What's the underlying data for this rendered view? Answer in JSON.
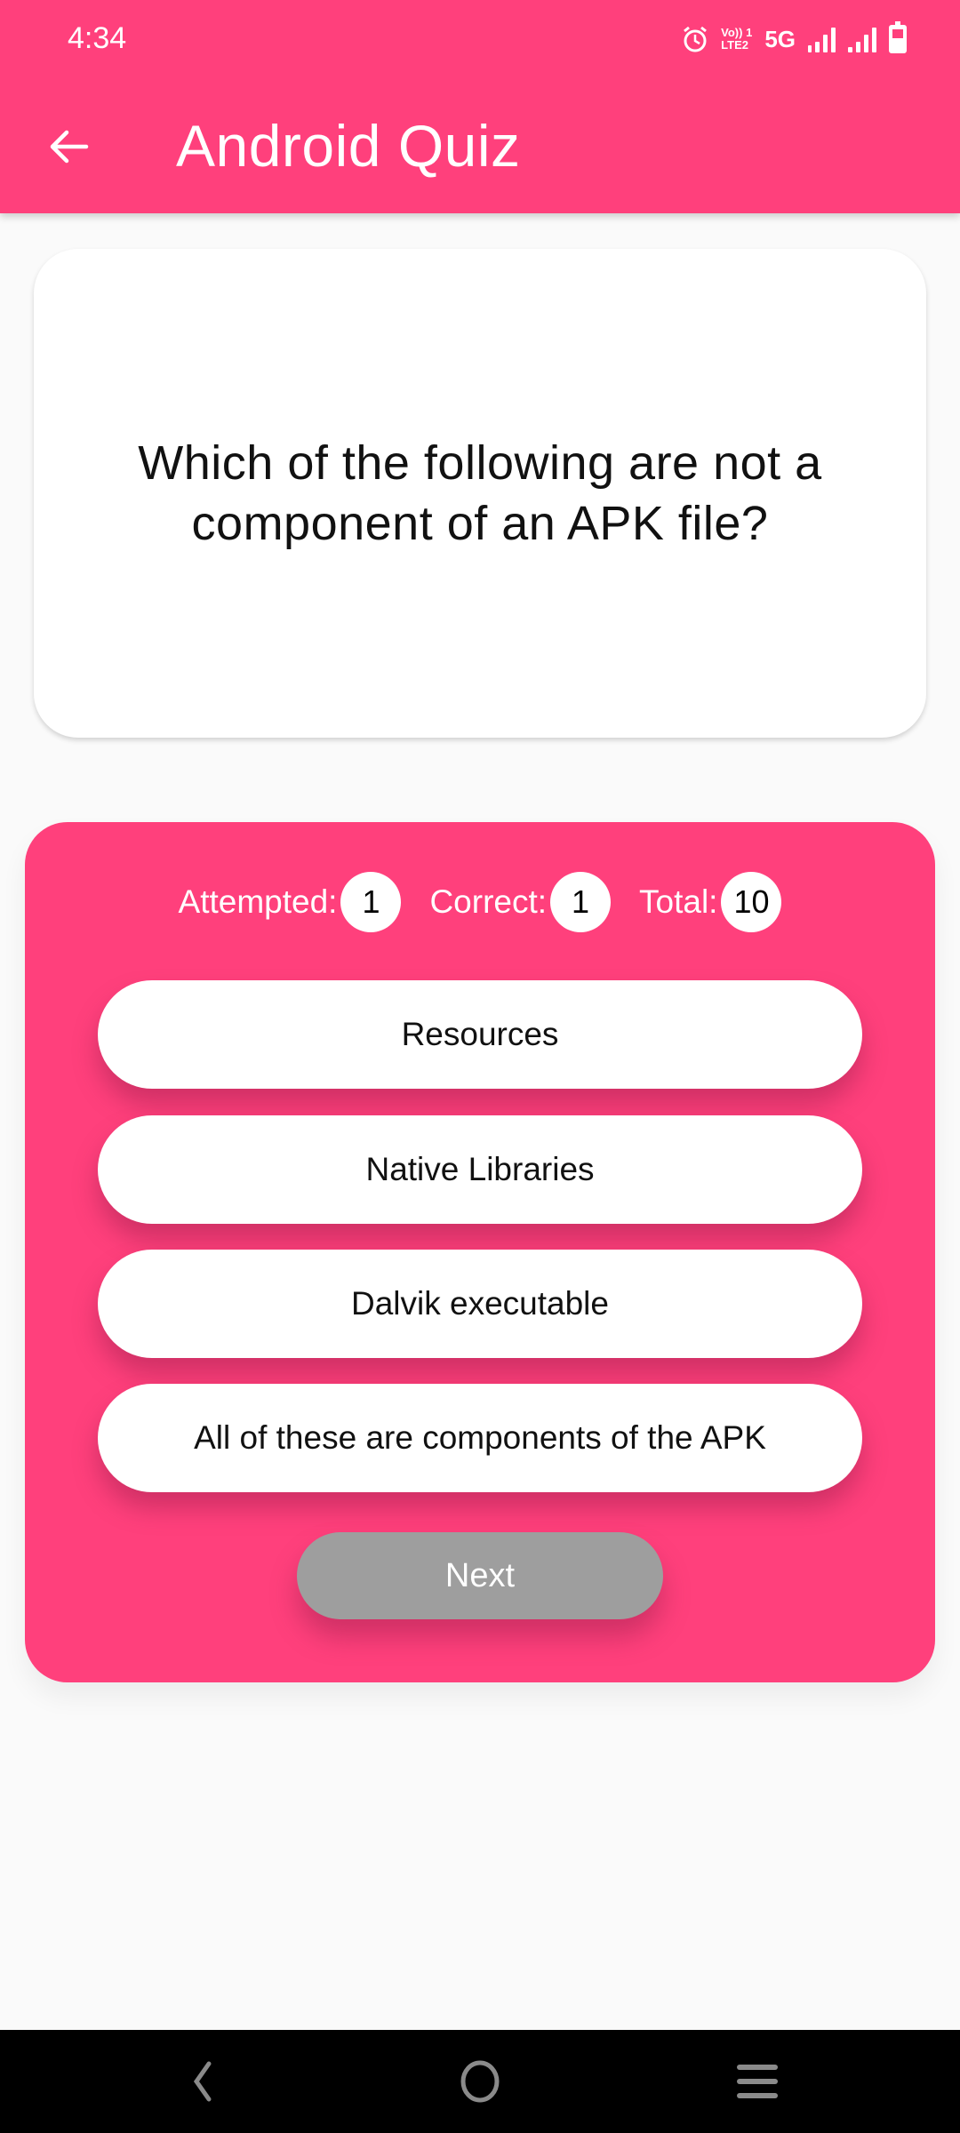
{
  "status_bar": {
    "time": "4:34",
    "icons": [
      "alarm-icon",
      "volte-lte2-icon",
      "5g-icon",
      "signal-sim1-icon",
      "signal-sim2-icon",
      "battery-icon"
    ],
    "volte_line1": "Vo)) 1",
    "volte_line2": "LTE2",
    "network": "5G"
  },
  "app_bar": {
    "back_icon": "arrow-left-icon",
    "title": "Android Quiz"
  },
  "question": {
    "text": "Which of the following are not a component of an APK file?"
  },
  "stats": {
    "attempted_label": "Attempted:",
    "attempted_value": "1",
    "correct_label": "Correct:",
    "correct_value": "1",
    "total_label": "Total:",
    "total_value": "10"
  },
  "options": [
    {
      "label": "Resources"
    },
    {
      "label": "Native Libraries"
    },
    {
      "label": "Dalvik executable"
    },
    {
      "label": "All of these are components of the APK"
    }
  ],
  "next_button": {
    "label": "Next",
    "enabled": false
  },
  "nav_bar": {
    "back_icon": "nav-back-icon",
    "home_icon": "nav-home-icon",
    "recents_icon": "nav-recents-icon"
  },
  "colors": {
    "primary": "#ff407c",
    "background": "#fafafa",
    "next_disabled": "#9e9e9e"
  }
}
